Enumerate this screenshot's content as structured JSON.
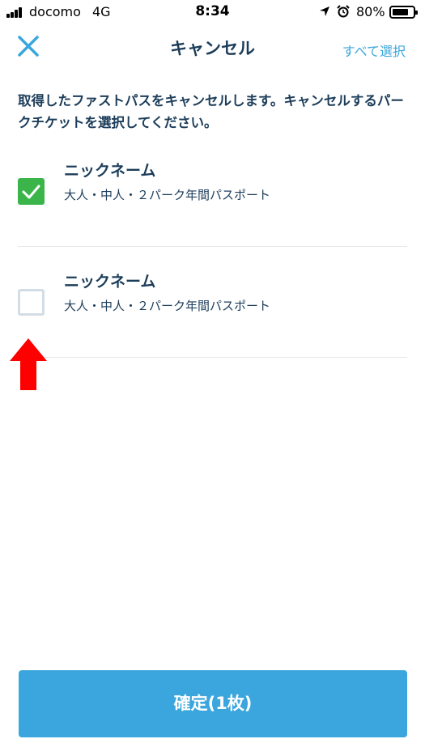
{
  "status_bar": {
    "carrier": "docomo",
    "network": "4G",
    "time": "8:34",
    "battery_percent": "80%",
    "battery_level": 0.8
  },
  "header": {
    "title": "キャンセル",
    "select_all_label": "すべて選択",
    "close_icon": "close-icon"
  },
  "instruction": "取得したファストパスをキャンセルします。キャンセルするパークチケットを選択してください。",
  "tickets": [
    {
      "nickname": "ニックネーム",
      "ticket_type": "大人・中人・２パーク年間パスポート",
      "checked": true
    },
    {
      "nickname": "ニックネーム",
      "ticket_type": "大人・中人・２パーク年間パスポート",
      "checked": false
    }
  ],
  "confirm_button": {
    "label": "確定(1枚)"
  },
  "colors": {
    "accent": "#3aa6dd",
    "text": "#1c3d5a",
    "checked": "#3bb54a",
    "arrow": "#ff0000"
  }
}
